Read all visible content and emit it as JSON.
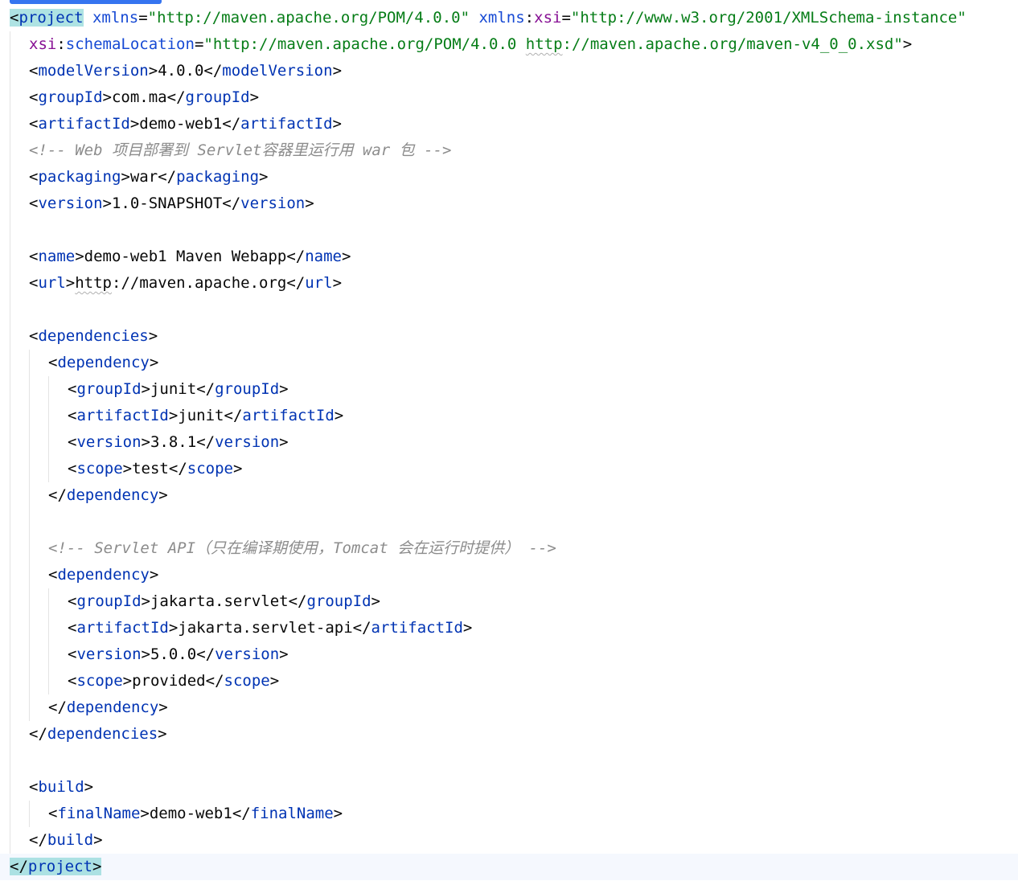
{
  "editor": {
    "lines": [
      {
        "indent": 0,
        "parts": [
          {
            "c": "brk",
            "m": true,
            "t": "<"
          },
          {
            "c": "tag",
            "m": true,
            "t": "project"
          },
          {
            "c": "txt",
            "t": " "
          },
          {
            "c": "attr",
            "t": "xmlns"
          },
          {
            "c": "brk",
            "t": "="
          },
          {
            "c": "val",
            "t": "\"http://maven.apache.org/POM/4.0.0\""
          },
          {
            "c": "txt",
            "t": " "
          },
          {
            "c": "attr",
            "t": "xmlns"
          },
          {
            "c": "brk",
            "t": ":"
          },
          {
            "c": "nsattr",
            "t": "xsi"
          },
          {
            "c": "brk",
            "t": "="
          },
          {
            "c": "val",
            "t": "\"http://www.w3.org/2001/XMLSchema-instance\""
          }
        ]
      },
      {
        "indent": 1,
        "parts": [
          {
            "c": "nsattr",
            "t": "xsi"
          },
          {
            "c": "brk",
            "t": ":"
          },
          {
            "c": "attr",
            "t": "schemaLocation"
          },
          {
            "c": "brk",
            "t": "="
          },
          {
            "c": "val",
            "t": "\"http://maven.apache.org/POM/4.0.0 "
          },
          {
            "c": "val",
            "t": "http",
            "s": true
          },
          {
            "c": "val",
            "t": "://maven.apache.org/maven-v4_0_0.xsd\""
          },
          {
            "c": "brk",
            "t": ">"
          }
        ]
      },
      {
        "indent": 1,
        "parts": [
          {
            "c": "brk",
            "t": "<"
          },
          {
            "c": "tag",
            "t": "modelVersion"
          },
          {
            "c": "brk",
            "t": ">"
          },
          {
            "c": "txt",
            "t": "4.0.0"
          },
          {
            "c": "brk",
            "t": "</"
          },
          {
            "c": "tag",
            "t": "modelVersion"
          },
          {
            "c": "brk",
            "t": ">"
          }
        ]
      },
      {
        "indent": 1,
        "parts": [
          {
            "c": "brk",
            "t": "<"
          },
          {
            "c": "tag",
            "t": "groupId"
          },
          {
            "c": "brk",
            "t": ">"
          },
          {
            "c": "txt",
            "t": "com.ma"
          },
          {
            "c": "brk",
            "t": "</"
          },
          {
            "c": "tag",
            "t": "groupId"
          },
          {
            "c": "brk",
            "t": ">"
          }
        ]
      },
      {
        "indent": 1,
        "parts": [
          {
            "c": "brk",
            "t": "<"
          },
          {
            "c": "tag",
            "t": "artifactId"
          },
          {
            "c": "brk",
            "t": ">"
          },
          {
            "c": "txt",
            "t": "demo-web1"
          },
          {
            "c": "brk",
            "t": "</"
          },
          {
            "c": "tag",
            "t": "artifactId"
          },
          {
            "c": "brk",
            "t": ">"
          }
        ]
      },
      {
        "indent": 1,
        "parts": [
          {
            "c": "cmt",
            "t": "<!-- Web 项目部署到 Servlet容器里运行用 war 包 -->"
          }
        ]
      },
      {
        "indent": 1,
        "parts": [
          {
            "c": "brk",
            "t": "<"
          },
          {
            "c": "tag",
            "t": "packaging"
          },
          {
            "c": "brk",
            "t": ">"
          },
          {
            "c": "txt",
            "t": "war"
          },
          {
            "c": "brk",
            "t": "</"
          },
          {
            "c": "tag",
            "t": "packaging"
          },
          {
            "c": "brk",
            "t": ">"
          }
        ]
      },
      {
        "indent": 1,
        "parts": [
          {
            "c": "brk",
            "t": "<"
          },
          {
            "c": "tag",
            "t": "version"
          },
          {
            "c": "brk",
            "t": ">"
          },
          {
            "c": "txt",
            "t": "1.0-SNAPSHOT"
          },
          {
            "c": "brk",
            "t": "</"
          },
          {
            "c": "tag",
            "t": "version"
          },
          {
            "c": "brk",
            "t": ">"
          }
        ]
      },
      {
        "indent": 0,
        "parts": []
      },
      {
        "indent": 1,
        "parts": [
          {
            "c": "brk",
            "t": "<"
          },
          {
            "c": "tag",
            "t": "name"
          },
          {
            "c": "brk",
            "t": ">"
          },
          {
            "c": "txt",
            "t": "demo-web1 Maven Webapp"
          },
          {
            "c": "brk",
            "t": "</"
          },
          {
            "c": "tag",
            "t": "name"
          },
          {
            "c": "brk",
            "t": ">"
          }
        ]
      },
      {
        "indent": 1,
        "parts": [
          {
            "c": "brk",
            "t": "<"
          },
          {
            "c": "tag",
            "t": "url"
          },
          {
            "c": "brk",
            "t": ">"
          },
          {
            "c": "txt",
            "t": "http",
            "s": true
          },
          {
            "c": "txt",
            "t": "://maven.apache.org"
          },
          {
            "c": "brk",
            "t": "</"
          },
          {
            "c": "tag",
            "t": "url"
          },
          {
            "c": "brk",
            "t": ">"
          }
        ]
      },
      {
        "indent": 0,
        "parts": []
      },
      {
        "indent": 1,
        "parts": [
          {
            "c": "brk",
            "t": "<"
          },
          {
            "c": "tag",
            "t": "dependencies"
          },
          {
            "c": "brk",
            "t": ">"
          }
        ]
      },
      {
        "indent": 2,
        "parts": [
          {
            "c": "brk",
            "t": "<"
          },
          {
            "c": "tag",
            "t": "dependency"
          },
          {
            "c": "brk",
            "t": ">"
          }
        ]
      },
      {
        "indent": 3,
        "parts": [
          {
            "c": "brk",
            "t": "<"
          },
          {
            "c": "tag",
            "t": "groupId"
          },
          {
            "c": "brk",
            "t": ">"
          },
          {
            "c": "txt",
            "t": "junit"
          },
          {
            "c": "brk",
            "t": "</"
          },
          {
            "c": "tag",
            "t": "groupId"
          },
          {
            "c": "brk",
            "t": ">"
          }
        ]
      },
      {
        "indent": 3,
        "parts": [
          {
            "c": "brk",
            "t": "<"
          },
          {
            "c": "tag",
            "t": "artifactId"
          },
          {
            "c": "brk",
            "t": ">"
          },
          {
            "c": "txt",
            "t": "junit"
          },
          {
            "c": "brk",
            "t": "</"
          },
          {
            "c": "tag",
            "t": "artifactId"
          },
          {
            "c": "brk",
            "t": ">"
          }
        ]
      },
      {
        "indent": 3,
        "parts": [
          {
            "c": "brk",
            "t": "<"
          },
          {
            "c": "tag",
            "t": "version"
          },
          {
            "c": "brk",
            "t": ">"
          },
          {
            "c": "txt",
            "t": "3.8.1"
          },
          {
            "c": "brk",
            "t": "</"
          },
          {
            "c": "tag",
            "t": "version"
          },
          {
            "c": "brk",
            "t": ">"
          }
        ]
      },
      {
        "indent": 3,
        "parts": [
          {
            "c": "brk",
            "t": "<"
          },
          {
            "c": "tag",
            "t": "scope"
          },
          {
            "c": "brk",
            "t": ">"
          },
          {
            "c": "txt",
            "t": "test"
          },
          {
            "c": "brk",
            "t": "</"
          },
          {
            "c": "tag",
            "t": "scope"
          },
          {
            "c": "brk",
            "t": ">"
          }
        ]
      },
      {
        "indent": 2,
        "parts": [
          {
            "c": "brk",
            "t": "</"
          },
          {
            "c": "tag",
            "t": "dependency"
          },
          {
            "c": "brk",
            "t": ">"
          }
        ]
      },
      {
        "indent": 0,
        "parts": []
      },
      {
        "indent": 2,
        "parts": [
          {
            "c": "cmt",
            "t": "<!-- Servlet API（只在编译期使用，Tomcat 会在运行时提供） -->"
          }
        ]
      },
      {
        "indent": 2,
        "parts": [
          {
            "c": "brk",
            "t": "<"
          },
          {
            "c": "tag",
            "t": "dependency"
          },
          {
            "c": "brk",
            "t": ">"
          }
        ]
      },
      {
        "indent": 3,
        "parts": [
          {
            "c": "brk",
            "t": "<"
          },
          {
            "c": "tag",
            "t": "groupId"
          },
          {
            "c": "brk",
            "t": ">"
          },
          {
            "c": "txt",
            "t": "jakarta.servlet"
          },
          {
            "c": "brk",
            "t": "</"
          },
          {
            "c": "tag",
            "t": "groupId"
          },
          {
            "c": "brk",
            "t": ">"
          }
        ]
      },
      {
        "indent": 3,
        "parts": [
          {
            "c": "brk",
            "t": "<"
          },
          {
            "c": "tag",
            "t": "artifactId"
          },
          {
            "c": "brk",
            "t": ">"
          },
          {
            "c": "txt",
            "t": "jakarta.servlet-api"
          },
          {
            "c": "brk",
            "t": "</"
          },
          {
            "c": "tag",
            "t": "artifactId"
          },
          {
            "c": "brk",
            "t": ">"
          }
        ]
      },
      {
        "indent": 3,
        "parts": [
          {
            "c": "brk",
            "t": "<"
          },
          {
            "c": "tag",
            "t": "version"
          },
          {
            "c": "brk",
            "t": ">"
          },
          {
            "c": "txt",
            "t": "5.0.0"
          },
          {
            "c": "brk",
            "t": "</"
          },
          {
            "c": "tag",
            "t": "version"
          },
          {
            "c": "brk",
            "t": ">"
          }
        ]
      },
      {
        "indent": 3,
        "parts": [
          {
            "c": "brk",
            "t": "<"
          },
          {
            "c": "tag",
            "t": "scope"
          },
          {
            "c": "brk",
            "t": ">"
          },
          {
            "c": "txt",
            "t": "provided"
          },
          {
            "c": "brk",
            "t": "</"
          },
          {
            "c": "tag",
            "t": "scope"
          },
          {
            "c": "brk",
            "t": ">"
          }
        ]
      },
      {
        "indent": 2,
        "parts": [
          {
            "c": "brk",
            "t": "</"
          },
          {
            "c": "tag",
            "t": "dependency"
          },
          {
            "c": "brk",
            "t": ">"
          }
        ]
      },
      {
        "indent": 1,
        "parts": [
          {
            "c": "brk",
            "t": "</"
          },
          {
            "c": "tag",
            "t": "dependencies"
          },
          {
            "c": "brk",
            "t": ">"
          }
        ]
      },
      {
        "indent": 0,
        "parts": []
      },
      {
        "indent": 1,
        "parts": [
          {
            "c": "brk",
            "t": "<"
          },
          {
            "c": "tag",
            "t": "build"
          },
          {
            "c": "brk",
            "t": ">"
          }
        ]
      },
      {
        "indent": 2,
        "parts": [
          {
            "c": "brk",
            "t": "<"
          },
          {
            "c": "tag",
            "t": "finalName"
          },
          {
            "c": "brk",
            "t": ">"
          },
          {
            "c": "txt",
            "t": "demo-web1"
          },
          {
            "c": "brk",
            "t": "</"
          },
          {
            "c": "tag",
            "t": "finalName"
          },
          {
            "c": "brk",
            "t": ">"
          }
        ]
      },
      {
        "indent": 1,
        "parts": [
          {
            "c": "brk",
            "t": "</"
          },
          {
            "c": "tag",
            "t": "build"
          },
          {
            "c": "brk",
            "t": ">"
          }
        ]
      },
      {
        "indent": 0,
        "caret": true,
        "parts": [
          {
            "c": "brk",
            "m": true,
            "t": "</"
          },
          {
            "c": "tag",
            "m": true,
            "t": "project"
          },
          {
            "c": "brk",
            "m": true,
            "t": ">"
          }
        ]
      }
    ]
  }
}
